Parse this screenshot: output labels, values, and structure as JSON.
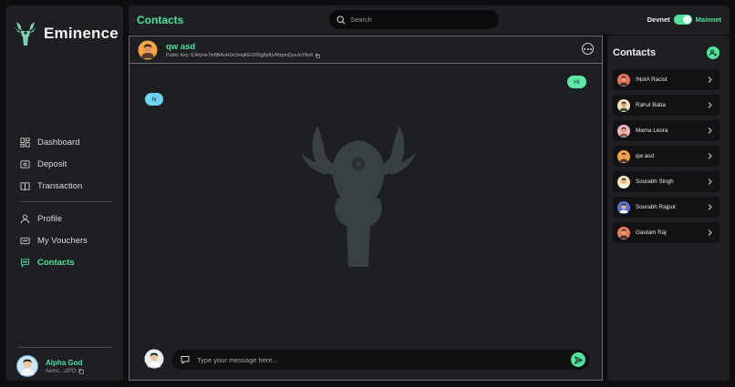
{
  "brand": {
    "name": "Eminence",
    "accent": "#4ee29c"
  },
  "sidebar": {
    "nav_top": [
      {
        "label": "Dashboard",
        "icon": "dashboard-icon"
      },
      {
        "label": "Deposit",
        "icon": "deposit-icon"
      },
      {
        "label": "Transaction",
        "icon": "book-icon"
      }
    ],
    "nav_bottom": [
      {
        "label": "Profile",
        "icon": "user-icon"
      },
      {
        "label": "My Vouchers",
        "icon": "voucher-icon"
      },
      {
        "label": "Contacts",
        "icon": "chat-icon",
        "active": true
      }
    ],
    "user": {
      "name": "Alpha God",
      "key": "Aemc...ctPD"
    }
  },
  "topbar": {
    "title": "Contacts",
    "search_placeholder": "Search",
    "network": {
      "left": "Devnet",
      "right": "Mainnet",
      "mainnet_on": true
    }
  },
  "chat": {
    "name": "qw asd",
    "public_key": "Public Key:  6JHyHe7m5BAuHUo3wqKEr1R5g8pKjvMzpmQyeJnY8oX",
    "messages": [
      {
        "direction": "out",
        "text": "HI"
      },
      {
        "direction": "in",
        "text": "hi"
      }
    ],
    "composer_placeholder": "Type your message here..."
  },
  "contacts_panel": {
    "title": "Contacts",
    "items": [
      {
        "name": "!NotA Racist"
      },
      {
        "name": "Rahul Baba"
      },
      {
        "name": "Mama Leora"
      },
      {
        "name": "qw asd"
      },
      {
        "name": "Sourabh Singh"
      },
      {
        "name": "Sourabh Rajput"
      },
      {
        "name": "Gautam Raj"
      }
    ]
  }
}
